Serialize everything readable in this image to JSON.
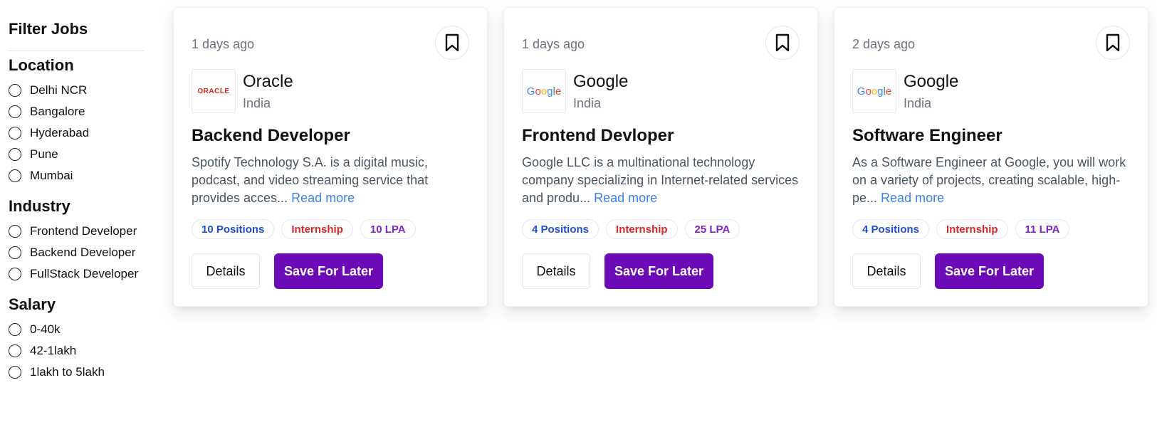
{
  "sidebar": {
    "title": "Filter Jobs",
    "groups": [
      {
        "title": "Location",
        "options": [
          "Delhi NCR",
          "Bangalore",
          "Hyderabad",
          "Pune",
          "Mumbai"
        ]
      },
      {
        "title": "Industry",
        "options": [
          "Frontend Developer",
          "Backend Developer",
          "FullStack Developer"
        ]
      },
      {
        "title": "Salary",
        "options": [
          "0-40k",
          "42-1lakh",
          "1lakh to 5lakh"
        ]
      }
    ]
  },
  "cards": [
    {
      "posted": "1 days ago",
      "company": "Oracle",
      "location": "India",
      "logo_text": "ORACLE",
      "role": "Backend Developer",
      "desc": "Spotify Technology S.A. is a digital music, podcast, and video streaming service that provides acces...",
      "read_more": "Read more",
      "positions": "10 Positions",
      "type": "Internship",
      "salary": "10 LPA",
      "details": "Details",
      "save": "Save For Later"
    },
    {
      "posted": "1 days ago",
      "company": "Google",
      "location": "India",
      "logo_text": "Google",
      "role": "Frontend Devloper",
      "desc": "Google LLC is a multinational technology company specializing in Internet-related services and produ...",
      "read_more": "Read more",
      "positions": "4 Positions",
      "type": "Internship",
      "salary": "25 LPA",
      "details": "Details",
      "save": "Save For Later"
    },
    {
      "posted": "2 days ago",
      "company": "Google",
      "location": "India",
      "logo_text": "Google",
      "role": "Software Engineer",
      "desc": "As a Software Engineer at Google, you will work on a variety of projects, creating scalable, high-pe...",
      "read_more": "Read more",
      "positions": "4 Positions",
      "type": "Internship",
      "salary": "11 LPA",
      "details": "Details",
      "save": "Save For Later"
    }
  ],
  "colors": {
    "accent": "#6d0ab8",
    "link": "#3b82f6",
    "positions": "#1d4ed8",
    "type": "#dc2626",
    "salary": "#7e22ce"
  }
}
